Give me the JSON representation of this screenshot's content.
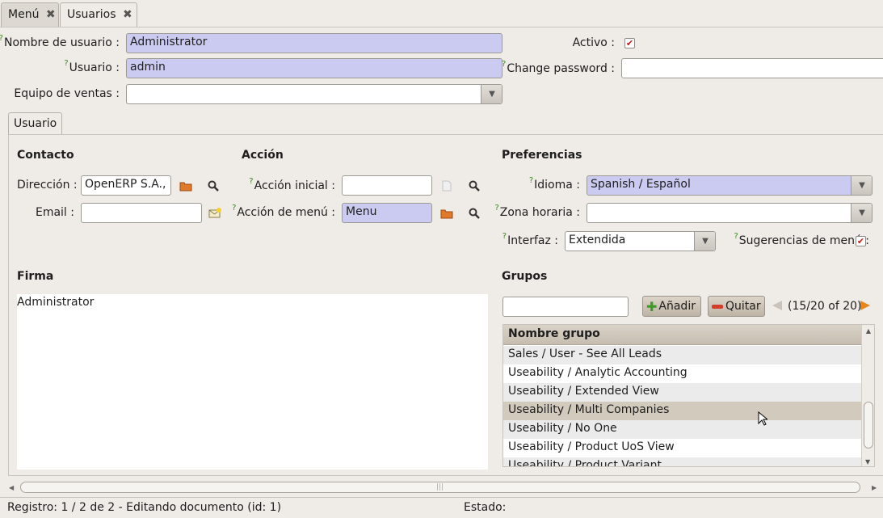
{
  "tabs": [
    {
      "label": "Menú"
    },
    {
      "label": "Usuarios"
    }
  ],
  "header": {
    "nombre_label": "Nombre de usuario :",
    "nombre_value": "Administrator",
    "usuario_label": "Usuario :",
    "usuario_value": "admin",
    "equipo_label": "Equipo de ventas :",
    "equipo_value": "",
    "activo_label": "Activo :",
    "change_pw_label": "Change password :",
    "change_pw_value": "",
    "help_mark": "?"
  },
  "inner_tab": {
    "label": "Usuario"
  },
  "contacto": {
    "title": "Contacto",
    "direccion_label": "Dirección :",
    "direccion_value": "OpenERP S.A., B",
    "email_label": "Email :",
    "email_value": ""
  },
  "accion": {
    "title": "Acción",
    "inicial_label": "Acción inicial :",
    "inicial_value": "",
    "menu_label": "Acción de menú :",
    "menu_value": "Menu"
  },
  "preferencias": {
    "title": "Preferencias",
    "idioma_label": "Idioma :",
    "idioma_value": "Spanish / Español",
    "zona_label": "Zona horaria :",
    "zona_value": "",
    "interfaz_label": "Interfaz :",
    "interfaz_value": "Extendida",
    "sugerencias_label": "Sugerencias de menú :"
  },
  "firma": {
    "title": "Firma",
    "value": "Administrator"
  },
  "grupos": {
    "title": "Grupos",
    "search_value": "",
    "add_label": "Añadir",
    "remove_label": "Quitar",
    "pager": "(15/20 of 20)",
    "column": "Nombre grupo",
    "rows": [
      "Sales / User - See All Leads",
      "Useability / Analytic Accounting",
      "Useability / Extended View",
      "Useability / Multi Companies",
      "Useability / No One",
      "Useability / Product UoS View",
      "Useability / Product Variant"
    ]
  },
  "status": {
    "registro": "Registro: 1 / 2 de 2 - Editando documento (id: 1)",
    "estado": "Estado:"
  },
  "colors": {
    "required_bg": "#cbcbf2",
    "window_bg": "#efebe7",
    "check_red": "#c31c14"
  }
}
